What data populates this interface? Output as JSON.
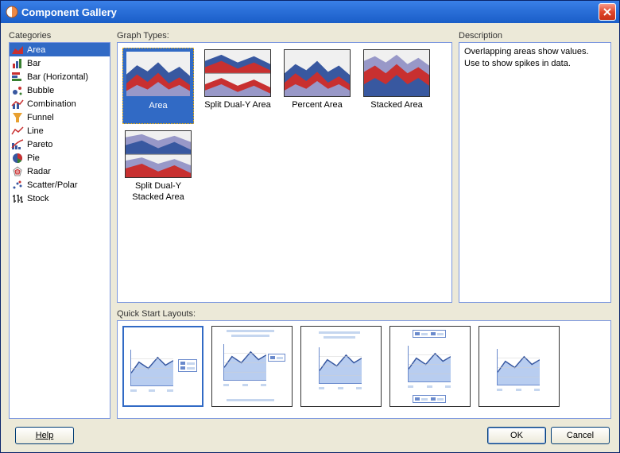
{
  "window": {
    "title": "Component Gallery"
  },
  "categories": {
    "label": "Categories",
    "items": [
      {
        "label": "Area",
        "icon": "area-icon",
        "selected": true
      },
      {
        "label": "Bar",
        "icon": "bar-icon"
      },
      {
        "label": "Bar (Horizontal)",
        "icon": "bar-horizontal-icon"
      },
      {
        "label": "Bubble",
        "icon": "bubble-icon"
      },
      {
        "label": "Combination",
        "icon": "combination-icon"
      },
      {
        "label": "Funnel",
        "icon": "funnel-icon"
      },
      {
        "label": "Line",
        "icon": "line-icon"
      },
      {
        "label": "Pareto",
        "icon": "pareto-icon"
      },
      {
        "label": "Pie",
        "icon": "pie-icon"
      },
      {
        "label": "Radar",
        "icon": "radar-icon"
      },
      {
        "label": "Scatter/Polar",
        "icon": "scatter-icon"
      },
      {
        "label": "Stock",
        "icon": "stock-icon"
      }
    ]
  },
  "graphTypes": {
    "label": "Graph Types:",
    "items": [
      {
        "label": "Area",
        "selected": true,
        "variant": "area"
      },
      {
        "label": "Split Dual-Y Area",
        "variant": "split-area"
      },
      {
        "label": "Percent Area",
        "variant": "area"
      },
      {
        "label": "Stacked Area",
        "variant": "stacked"
      },
      {
        "label": "Split Dual-Y Stacked Area",
        "variant": "split-stacked"
      }
    ]
  },
  "description": {
    "label": "Description",
    "text": "Overlapping areas show values. Use to show spikes in data."
  },
  "quickStart": {
    "label": "Quick Start Layouts:",
    "items": [
      {
        "variant": "chart-legend-right",
        "selected": true
      },
      {
        "variant": "title-chart-footer"
      },
      {
        "variant": "title-chart-wide"
      },
      {
        "variant": "legend-top-bottom"
      },
      {
        "variant": "chart-only"
      }
    ]
  },
  "buttons": {
    "help": "Help",
    "ok": "OK",
    "cancel": "Cancel"
  },
  "colors": {
    "selection": "#316ac5",
    "panel_border": "#7a96df",
    "chart_blue": "#3858a0",
    "chart_red": "#c83030",
    "chart_purple": "#9898c8"
  }
}
